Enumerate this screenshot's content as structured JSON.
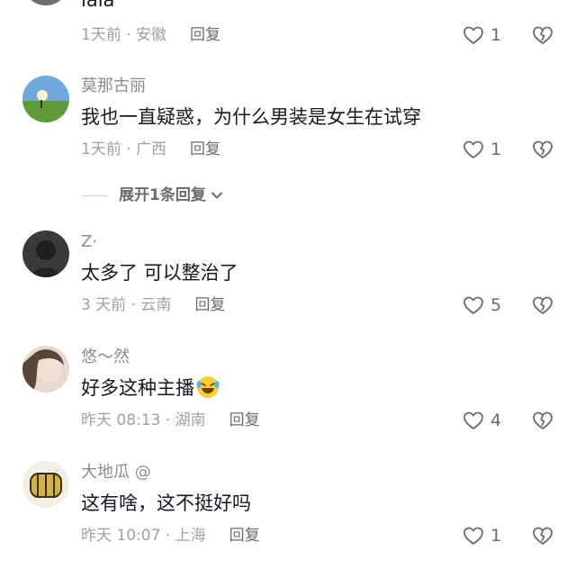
{
  "comments": [
    {
      "text": "lala",
      "meta": "1天前 · 安徽",
      "reply": "回复",
      "likes": "1"
    },
    {
      "username": "莫那古丽",
      "text": "我也一直疑惑，为什么男装是女生在试穿",
      "meta": "1天前 · 广西",
      "reply": "回复",
      "likes": "1",
      "expand": "展开1条回复"
    },
    {
      "username": "Z·",
      "text": "太多了 可以整治了",
      "meta": "3 天前 · 云南",
      "reply": "回复",
      "likes": "5"
    },
    {
      "username": "悠～然",
      "text": "好多这种主播",
      "meta": "昨天 08:13 · 湖南",
      "reply": "回复",
      "likes": "4"
    },
    {
      "username": "大地瓜 @",
      "text": "这有啥，这不挺好吗",
      "meta": "昨天 10:07 · 上海",
      "reply": "回复",
      "likes": "1"
    }
  ],
  "icons": {
    "like": "heart-outline-icon",
    "dislike": "broken-heart-icon",
    "expand": "chevron-down-icon",
    "emoji": "rofl-emoji-icon"
  },
  "colors": {
    "text": "#161823",
    "muted": "#a0a0a0",
    "username": "#8c8c8c",
    "action": "#6b6b6b"
  }
}
